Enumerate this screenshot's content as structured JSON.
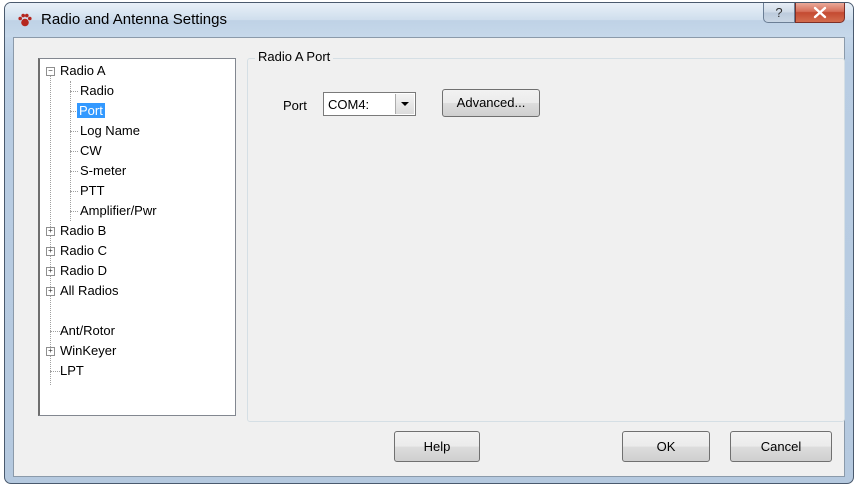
{
  "window": {
    "title": "Radio and Antenna Settings",
    "help_glyph": "?",
    "close_glyph": "x"
  },
  "tree": {
    "root": {
      "label": "Radio A",
      "expander": "−",
      "children": [
        "Radio",
        "Port",
        "Log Name",
        "CW",
        "S-meter",
        "PTT",
        "Amplifier/Pwr"
      ],
      "selected": "Port"
    },
    "siblings": [
      {
        "label": "Radio B",
        "expander": "+"
      },
      {
        "label": "Radio C",
        "expander": "+"
      },
      {
        "label": "Radio D",
        "expander": "+"
      },
      {
        "label": "All Radios",
        "expander": "+"
      },
      {
        "label": "Ant/Rotor",
        "expander": ""
      },
      {
        "label": "WinKeyer",
        "expander": "+"
      },
      {
        "label": "LPT",
        "expander": ""
      }
    ]
  },
  "panel": {
    "group_title": "Radio A Port",
    "port_label": "Port",
    "port_value": "COM4:",
    "advanced_button": "Advanced..."
  },
  "footer": {
    "help_button": "Help",
    "ok_button": "OK",
    "cancel_button": "Cancel"
  },
  "colors": {
    "selection": "#3399ff",
    "title_icon": "#c0392b"
  }
}
